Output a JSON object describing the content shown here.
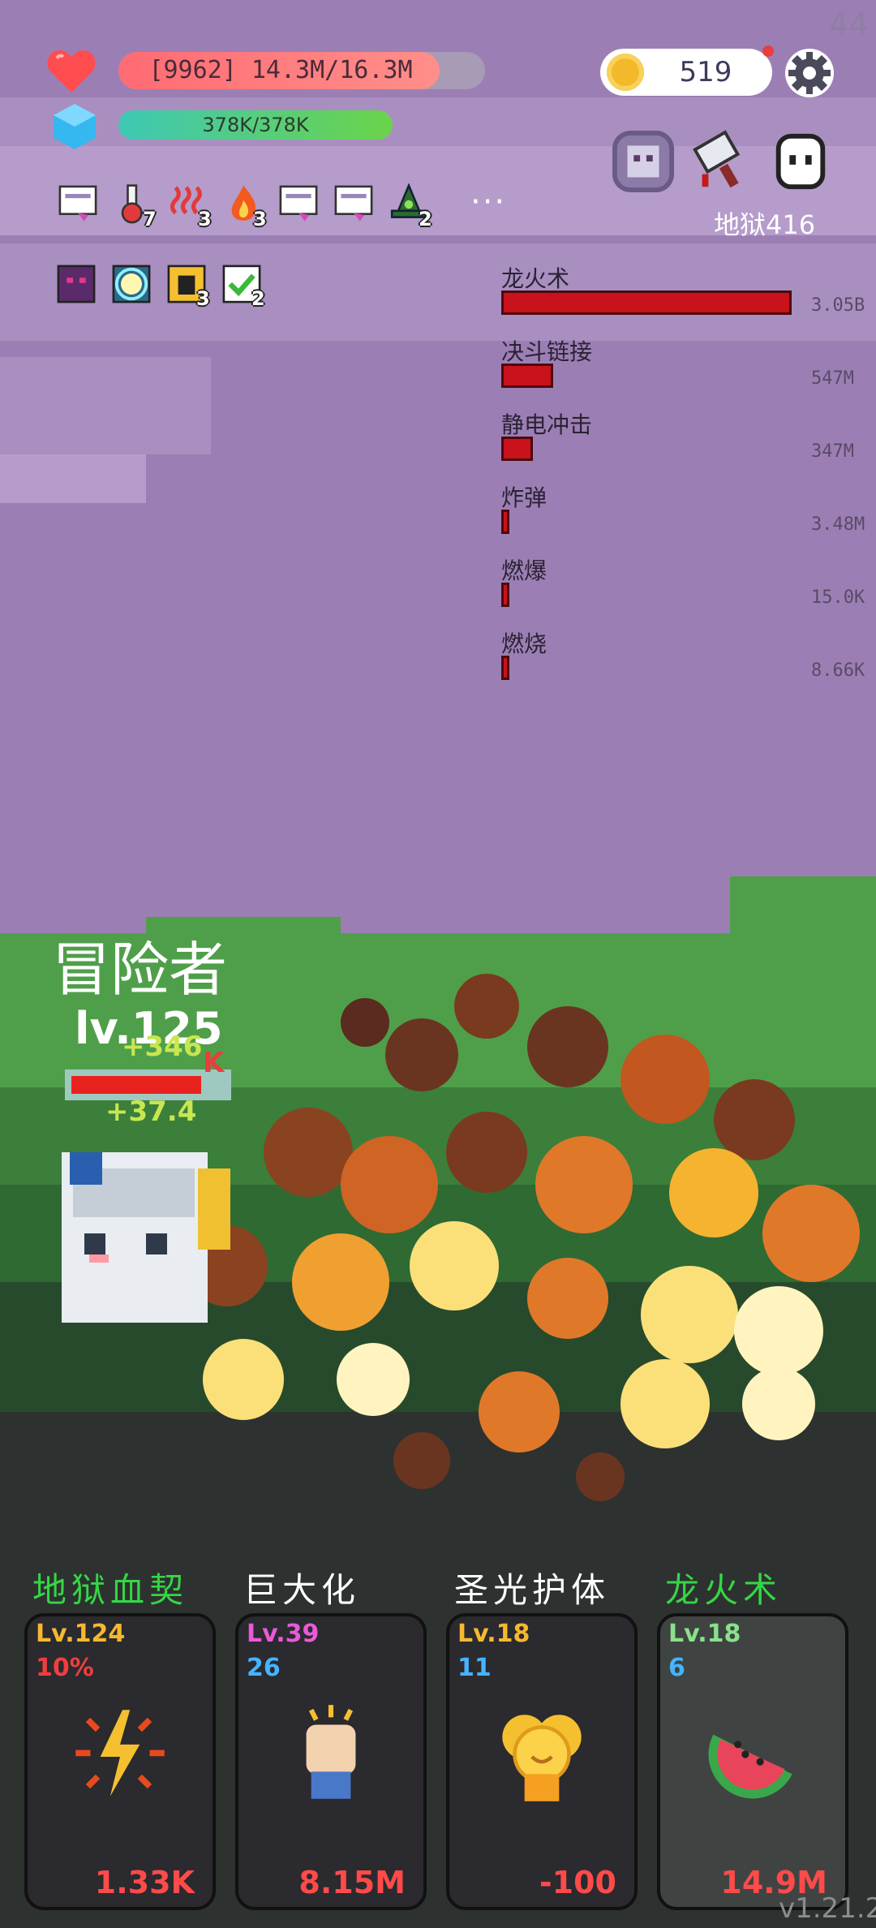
{
  "status": {
    "fps": "44",
    "hp_text": "[9962] 14.3M/16.3M",
    "hp_fraction": 0.877,
    "mp_text": "378K/378K",
    "mp_fraction": 1.0,
    "coins": "519"
  },
  "stage": {
    "label": "地狱416"
  },
  "buffs": {
    "row1": [
      {
        "icon": "scroll-icon",
        "count": ""
      },
      {
        "icon": "potion-icon",
        "count": "7"
      },
      {
        "icon": "heat-waves-icon",
        "count": "3"
      },
      {
        "icon": "fire-icon",
        "count": "3"
      },
      {
        "icon": "scroll-icon",
        "count": ""
      },
      {
        "icon": "scroll-icon",
        "count": ""
      },
      {
        "icon": "witch-hat-icon",
        "count": "2"
      }
    ],
    "more": "···",
    "row2": [
      {
        "icon": "demon-icon",
        "count": ""
      },
      {
        "icon": "light-orb-icon",
        "count": ""
      },
      {
        "icon": "dark-figure-icon",
        "count": "3"
      },
      {
        "icon": "checkmark-icon",
        "count": "2"
      }
    ]
  },
  "damage_stats": [
    {
      "name": "龙火术",
      "value": "3.05B",
      "fraction": 1.0
    },
    {
      "name": "决斗链接",
      "value": "547M",
      "fraction": 0.18
    },
    {
      "name": "静电冲击",
      "value": "347M",
      "fraction": 0.11
    },
    {
      "name": "炸弹",
      "value": "3.48M",
      "fraction": 0.02
    },
    {
      "name": "燃爆",
      "value": "15.0K",
      "fraction": 0.02
    },
    {
      "name": "燃烧",
      "value": "8.66K",
      "fraction": 0.02
    }
  ],
  "character": {
    "name": "冒险者",
    "level": "lv.125",
    "floating": [
      "+346",
      "+37.4",
      "K"
    ]
  },
  "skills": [
    {
      "title": "地狱血契",
      "title_color": "#35d645",
      "level": "Lv.124",
      "level_color": "#f5b82e",
      "value": "10%",
      "value_color": "#f23d3d",
      "cost": "1.33K",
      "icon": "lightning-burst-icon"
    },
    {
      "title": "巨大化",
      "title_color": "#ffffff",
      "level": "Lv.39",
      "level_color": "#e85ad8",
      "value": "26",
      "value_color": "#46b4ff",
      "cost": "8.15M",
      "icon": "raised-fist-icon"
    },
    {
      "title": "圣光护体",
      "title_color": "#ffffff",
      "level": "Lv.18",
      "level_color": "#f5b82e",
      "value": "11",
      "value_color": "#46b4ff",
      "cost": "-100",
      "icon": "golden-shield-icon"
    },
    {
      "title": "龙火术",
      "title_color": "#35d645",
      "level": "Lv.18",
      "level_color": "#8be08b",
      "value": "6",
      "value_color": "#46b4ff",
      "cost": "14.9M",
      "icon": "watermelon-icon"
    }
  ],
  "version": "v1.21.2",
  "colors": {
    "sky": "#9b7fb4",
    "ground": "#2d3a2c",
    "accent_red": "#c9121c"
  }
}
